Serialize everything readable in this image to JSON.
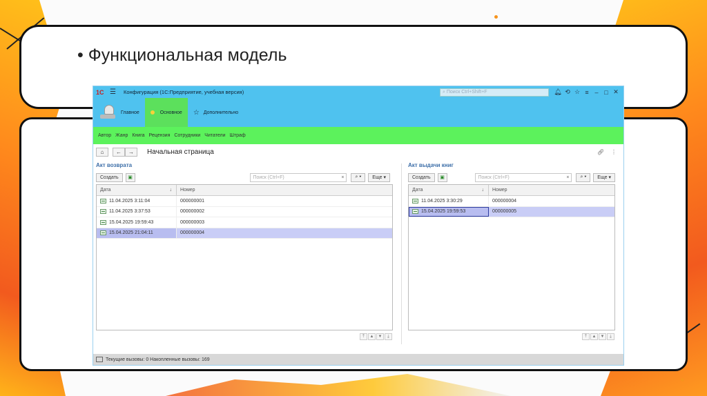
{
  "slide": {
    "title_bullet": "•",
    "title": "Функциональная модель"
  },
  "app": {
    "logo": "1С",
    "window_title": "Конфигурация  (1С:Предприятие, учебная версия)",
    "search_placeholder": "Поиск Ctrl+Shift+F",
    "sections": [
      {
        "label": "Главное",
        "icon": "home-icon"
      },
      {
        "label": "Основное",
        "icon": "dot-icon"
      },
      {
        "label": "Дополнительно",
        "icon": "star-icon"
      }
    ],
    "subnav": [
      "Автор",
      "Жанр",
      "Книга",
      "Рецензия",
      "Сотрудники",
      "Читатели",
      "Штраф"
    ],
    "page_title": "Начальная страница",
    "left_panel": {
      "title": "Акт возврата",
      "create_label": "Создать",
      "search_placeholder": "Поиск (Ctrl+F)",
      "more_label": "Еще",
      "col_date": "Дата",
      "col_number": "Номер",
      "rows": [
        {
          "date": "11.04.2025 3:11:04",
          "number": "000000001"
        },
        {
          "date": "11.04.2025 3:37:53",
          "number": "000000002"
        },
        {
          "date": "15.04.2025 19:59:43",
          "number": "000000003"
        },
        {
          "date": "15.04.2025 21:04:11",
          "number": "000000004"
        }
      ]
    },
    "right_panel": {
      "title": "Акт выдачи книг",
      "create_label": "Создать",
      "search_placeholder": "Поиск (Ctrl+F)",
      "more_label": "Еще",
      "col_date": "Дата",
      "col_number": "Номер",
      "rows": [
        {
          "date": "11.04.2025 3:30:29",
          "number": "000000004"
        },
        {
          "date": "15.04.2025 19:59:53",
          "number": "000000005"
        }
      ]
    },
    "status": "Текущие вызовы: 0   Накопленные вызовы: 169"
  },
  "colors": {
    "titlebar": "#4fc2ef",
    "active_section": "#5ce05c",
    "subnav": "#5cf25c",
    "selected_row": "#c9cdf6"
  }
}
